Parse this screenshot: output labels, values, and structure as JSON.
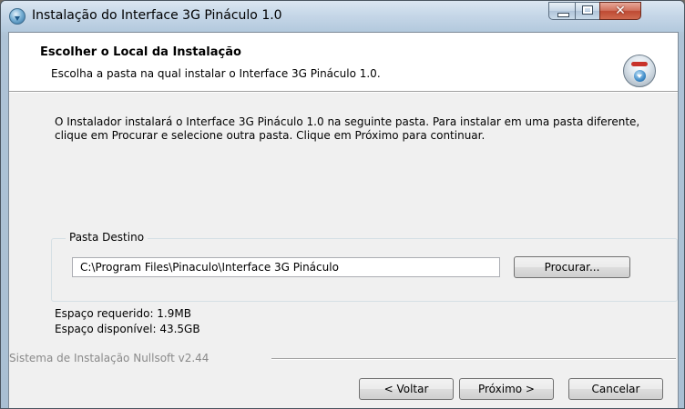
{
  "window": {
    "title": "Instalação do Interface 3G Pináculo 1.0",
    "controls": {
      "minimize": "minimize-glyph",
      "maximize": "maximize-glyph",
      "close": "✕"
    }
  },
  "header": {
    "title": "Escolher o Local da Instalação",
    "subtitle": "Escolha a pasta na qual instalar o Interface 3G Pináculo 1.0.",
    "icon": "installer-disc-icon"
  },
  "body": {
    "description": "O Instalador instalará o Interface 3G Pináculo 1.0 na seguinte pasta. Para instalar em uma pasta diferente, clique em Procurar e selecione outra pasta. Clique em Próximo para continuar."
  },
  "destination": {
    "group_label": "Pasta Destino",
    "path_value": "C:\\Program Files\\Pinaculo\\Interface 3G Pináculo",
    "browse_label": "Procurar..."
  },
  "space": {
    "required": "Espaço requerido: 1.9MB",
    "available": "Espaço disponível: 43.5GB"
  },
  "footer": {
    "branding": "Sistema de Instalação Nullsoft v2.44",
    "back_label": "< Voltar",
    "next_label": "Próximo >",
    "cancel_label": "Cancelar"
  },
  "colors": {
    "title_bar": "#c6d7e8",
    "close_button": "#c7503a",
    "dialog_background": "#f0f0f0",
    "header_background": "#ffffff",
    "branding_text": "#8a8a8a"
  }
}
